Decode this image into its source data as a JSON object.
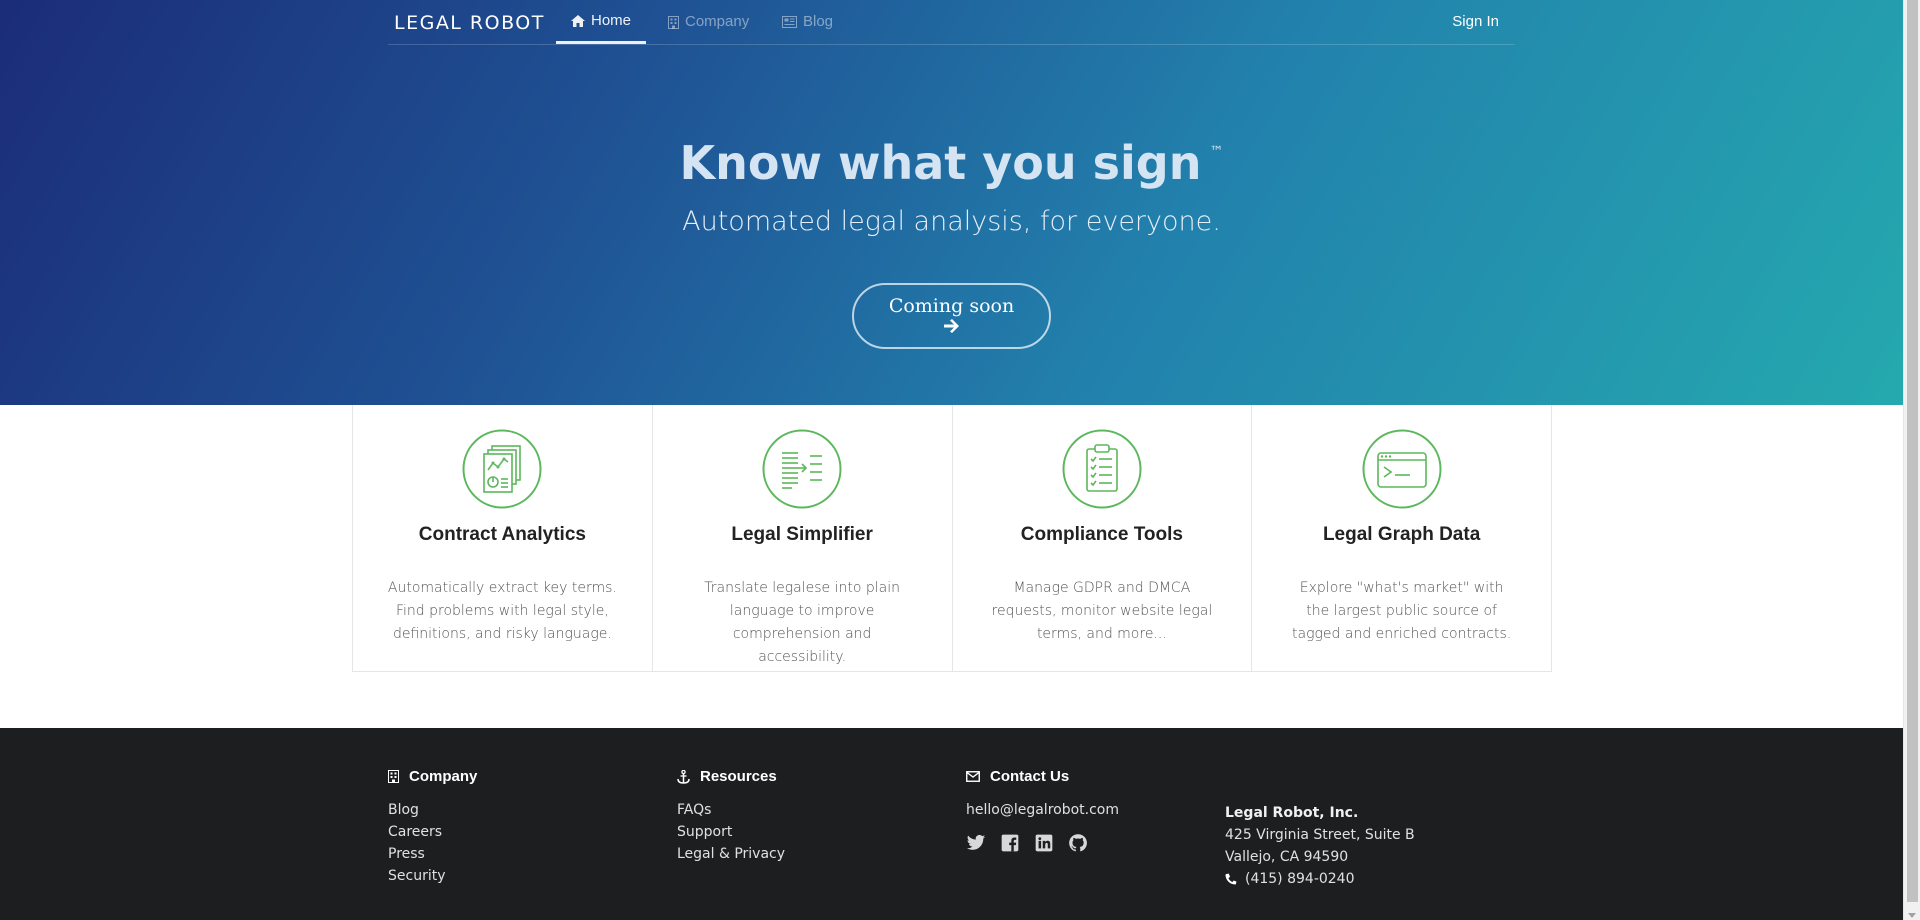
{
  "nav": {
    "brand": "LEGAL ROBOT",
    "items": [
      {
        "label": "Home",
        "icon": "home-icon",
        "active": true
      },
      {
        "label": "Company",
        "icon": "building-icon",
        "active": false
      },
      {
        "label": "Blog",
        "icon": "newspaper-icon",
        "active": false
      }
    ],
    "signin": "Sign In"
  },
  "hero": {
    "title": "Know what you sign",
    "tm": "™",
    "subtitle": "Automated legal analysis, for everyone.",
    "cta": "Coming soon"
  },
  "features": [
    {
      "title": "Contract Analytics",
      "desc": "Automatically extract key terms. Find problems with legal style, definitions, and risky language.",
      "icon": "analytics-document-icon"
    },
    {
      "title": "Legal Simplifier",
      "desc": "Translate legalese into plain language to improve comprehension and accessibility.",
      "icon": "text-simplify-icon"
    },
    {
      "title": "Compliance Tools",
      "desc": "Manage GDPR and DMCA requests, monitor website legal terms, and more...",
      "icon": "clipboard-checklist-icon"
    },
    {
      "title": "Legal Graph Data",
      "desc": "Explore \"what's market\" with the largest public source of tagged and enriched contracts.",
      "icon": "terminal-window-icon"
    }
  ],
  "footer": {
    "company": {
      "heading": "Company",
      "links": [
        "Blog",
        "Careers",
        "Press",
        "Security"
      ]
    },
    "resources": {
      "heading": "Resources",
      "links": [
        "FAQs",
        "Support",
        "Legal & Privacy"
      ]
    },
    "contact": {
      "heading": "Contact Us",
      "email": "hello@legalrobot.com",
      "socials": [
        "twitter-icon",
        "facebook-icon",
        "linkedin-icon",
        "github-icon"
      ]
    },
    "address": {
      "name": "Legal Robot, Inc.",
      "line1": "425 Virginia Street, Suite B",
      "line2": "Vallejo, CA 94590",
      "phone": "(415) 894-0240"
    }
  },
  "colors": {
    "hero_start": "#1b2c78",
    "hero_end": "#25a9ae",
    "accent_green": "#5cb85c",
    "footer_bg": "#1d1e20"
  }
}
